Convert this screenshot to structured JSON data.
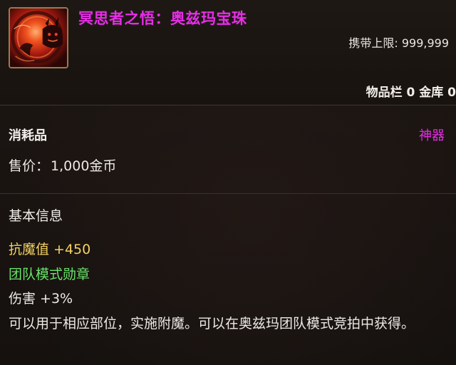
{
  "item": {
    "title": "冥思者之悟：奥兹玛宝珠",
    "icon": "demon-eye-orb-icon",
    "carry_limit_label": "携带上限",
    "carry_limit_value": "999,999",
    "inventory_text": "物品栏 0 金库 0"
  },
  "category": {
    "type": "消耗品",
    "rarity": "神器",
    "price_label": "售价",
    "price_value": "1,000金币"
  },
  "info": {
    "heading": "基本信息",
    "magic_resist": "抗魔值 +450",
    "badge_type": "团队模式勋章",
    "damage": "伤害 +3%",
    "description": "可以用于相应部位，实施附魔。可以在奥兹玛团队模式竞拍中获得。"
  },
  "colors": {
    "title": "#e62ee6",
    "rarity": "#e62ee6",
    "magic_resist": "#f2d265",
    "badge_type": "#67e36a",
    "text": "#ece9e4",
    "background": "#1a1512",
    "icon_border": "#9a7a4f"
  }
}
